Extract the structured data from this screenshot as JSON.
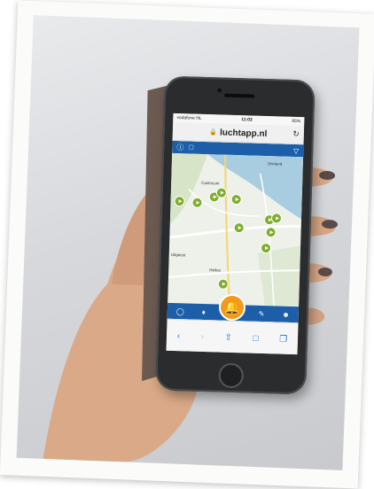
{
  "status_bar": {
    "carrier": "vodafone NL",
    "time": "11:03",
    "battery": "95%"
  },
  "browser": {
    "url": "luchtapp.nl"
  },
  "map": {
    "labels": {
      "town1": "Zeeland",
      "town2": "Castricum",
      "town3": "Heiloo",
      "town4": "Castricum aan Zee",
      "town5": "Uitgeest"
    }
  },
  "icons": {
    "help": "help-icon",
    "chat": "chat-icon",
    "filter": "filter-icon",
    "globe": "globe-icon",
    "bell": "bell-icon",
    "pencil": "pencil-icon",
    "user": "user-icon"
  },
  "colors": {
    "app_blue": "#1c5fa8",
    "marker_green": "#7fae2e",
    "fab_orange": "#f29a1b",
    "sea": "#a9cde0"
  }
}
